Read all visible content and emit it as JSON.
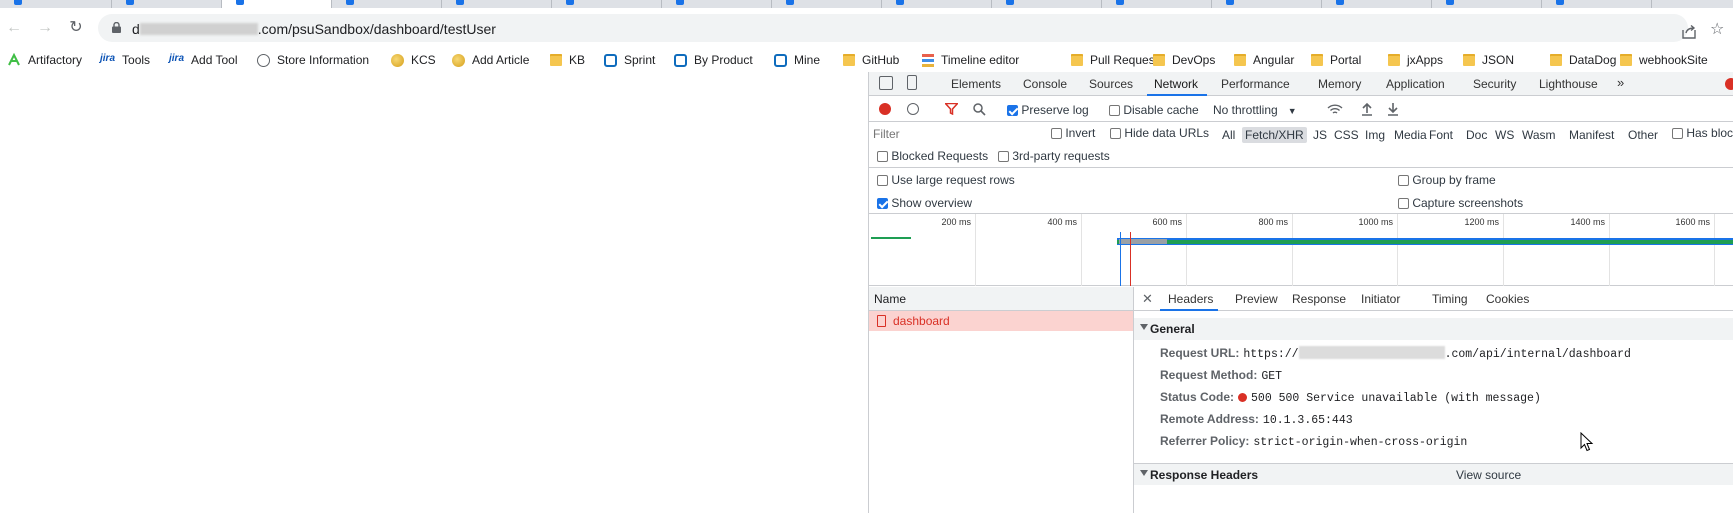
{
  "browser": {
    "url_prefix": "d",
    "url_suffix": ".com/psuSandbox/dashboard/testUser"
  },
  "bookmarks": [
    {
      "label": "Artifactory",
      "icon": "artifactory-icon"
    },
    {
      "label": "Tools",
      "icon": "jira-icon"
    },
    {
      "label": "Add Tool",
      "icon": "jira-icon"
    },
    {
      "label": "Store Information",
      "icon": "globe-icon"
    },
    {
      "label": "KCS",
      "icon": "coin-icon"
    },
    {
      "label": "Add Article",
      "icon": "coin-icon"
    },
    {
      "label": "KB",
      "icon": "folder-icon"
    },
    {
      "label": "Sprint",
      "icon": "azure-icon"
    },
    {
      "label": "By Product",
      "icon": "azure-icon"
    },
    {
      "label": "Mine",
      "icon": "azure-icon"
    },
    {
      "label": "GitHub",
      "icon": "folder-icon"
    },
    {
      "label": "Timeline editor",
      "icon": "timeline-icon"
    },
    {
      "label": "Pull Requests",
      "icon": "folder-icon"
    },
    {
      "label": "DevOps",
      "icon": "folder-icon"
    },
    {
      "label": "Angular",
      "icon": "folder-icon"
    },
    {
      "label": "Portal",
      "icon": "folder-icon"
    },
    {
      "label": "jxApps",
      "icon": "folder-icon"
    },
    {
      "label": "JSON",
      "icon": "folder-icon"
    },
    {
      "label": "DataDog",
      "icon": "folder-icon"
    },
    {
      "label": "webhookSite",
      "icon": "folder-icon"
    }
  ],
  "devtools": {
    "tabs": [
      "Elements",
      "Console",
      "Sources",
      "Network",
      "Performance",
      "Memory",
      "Application",
      "Security",
      "Lighthouse"
    ],
    "active_tab": "Network",
    "more_tabs": "»",
    "toolbar": {
      "preserve_log": "Preserve log",
      "preserve_log_checked": true,
      "disable_cache": "Disable cache",
      "disable_cache_checked": false,
      "throttling": "No throttling"
    },
    "filter": {
      "placeholder": "Filter",
      "invert": "Invert",
      "hide_data_urls": "Hide data URLs",
      "types": [
        "All",
        "Fetch/XHR",
        "JS",
        "CSS",
        "Img",
        "Media",
        "Font",
        "Doc",
        "WS",
        "Wasm",
        "Manifest",
        "Other"
      ],
      "selected_type": "Fetch/XHR",
      "has_blocked": "Has bloc",
      "blocked_requests": "Blocked Requests",
      "third_party": "3rd-party requests"
    },
    "options": {
      "large_rows": "Use large request rows",
      "large_rows_checked": false,
      "show_overview": "Show overview",
      "show_overview_checked": true,
      "group_by_frame": "Group by frame",
      "capture_screenshots": "Capture screenshots"
    },
    "overview_ticks": [
      "200 ms",
      "400 ms",
      "600 ms",
      "800 ms",
      "1000 ms",
      "1200 ms",
      "1400 ms",
      "1600 ms"
    ],
    "requests": {
      "column_name": "Name",
      "rows": [
        {
          "name": "dashboard",
          "status": "error"
        }
      ]
    },
    "detail": {
      "tabs": [
        "Headers",
        "Preview",
        "Response",
        "Initiator",
        "Timing",
        "Cookies"
      ],
      "active_tab": "Headers",
      "general_title": "General",
      "request_url_key": "Request URL:",
      "request_url_prefix": "https://",
      "request_url_suffix": ".com/api/internal/dashboard",
      "request_method_key": "Request Method:",
      "request_method": "GET",
      "status_code_key": "Status Code:",
      "status_code": "500 500 Service unavailable (with message)",
      "remote_address_key": "Remote Address:",
      "remote_address": "10.1.3.65:443",
      "referrer_policy_key": "Referrer Policy:",
      "referrer_policy": "strict-origin-when-cross-origin",
      "response_headers_title": "Response Headers",
      "view_source": "View source"
    }
  }
}
